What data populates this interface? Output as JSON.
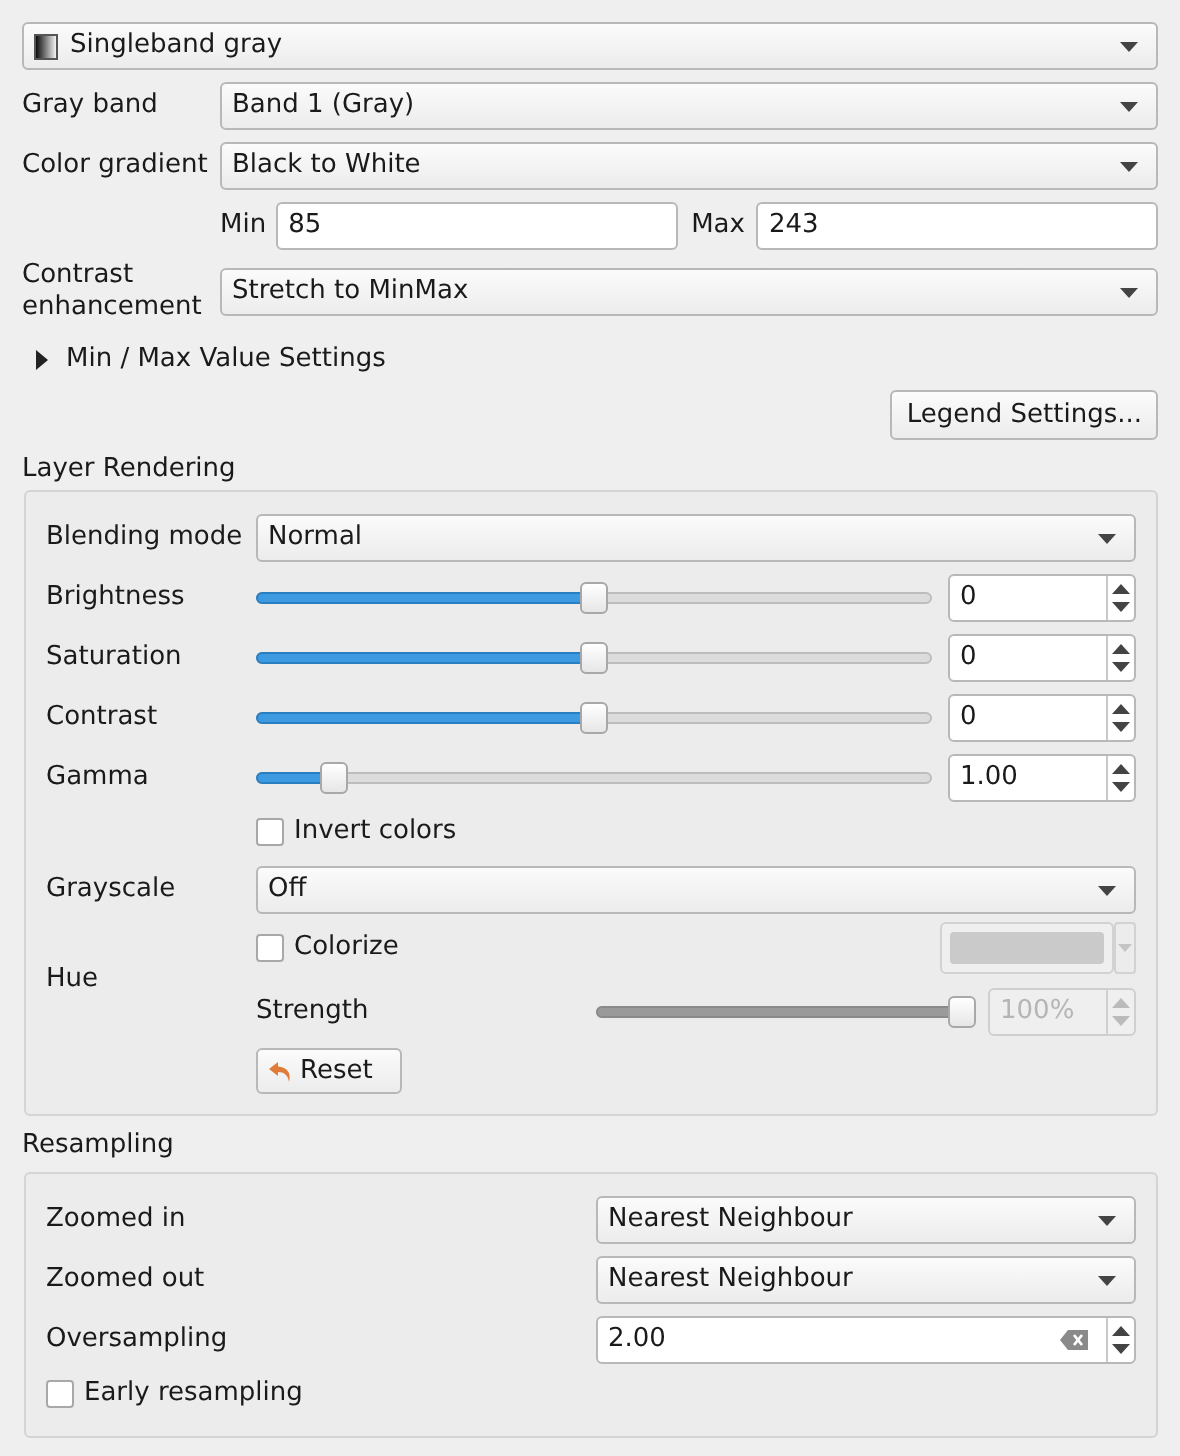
{
  "renderer": {
    "value": "Singleband gray"
  },
  "gray_band": {
    "label": "Gray band",
    "value": "Band 1 (Gray)"
  },
  "color_gradient": {
    "label": "Color gradient",
    "value": "Black to White"
  },
  "min": {
    "label": "Min",
    "value": "85"
  },
  "max": {
    "label": "Max",
    "value": "243"
  },
  "contrast_enhancement": {
    "label": "Contrast enhancement",
    "value": "Stretch to MinMax"
  },
  "min_max_settings": {
    "label": "Min / Max Value Settings",
    "expanded": false
  },
  "legend_button": "Legend Settings...",
  "layer_rendering": {
    "title": "Layer Rendering",
    "blending_mode": {
      "label": "Blending mode",
      "value": "Normal"
    },
    "sliders": [
      {
        "label": "Brightness",
        "level": 0.5,
        "value": "0"
      },
      {
        "label": "Saturation",
        "level": 0.5,
        "value": "0"
      },
      {
        "label": "Contrast",
        "level": 0.5,
        "value": "0"
      },
      {
        "label": "Gamma",
        "level": 0.1,
        "value": "1.00"
      }
    ],
    "invert_colors": {
      "label": "Invert colors",
      "checked": false
    },
    "grayscale": {
      "label": "Grayscale",
      "value": "Off"
    },
    "hue": {
      "label": "Hue",
      "colorize": {
        "label": "Colorize",
        "checked": false
      },
      "color_button": {
        "disabled": true
      },
      "strength": {
        "label": "Strength",
        "level": 1,
        "value": "100%",
        "disabled": true
      },
      "reset": "Reset"
    }
  },
  "resampling": {
    "title": "Resampling",
    "zoomed_in": {
      "label": "Zoomed in",
      "value": "Nearest Neighbour"
    },
    "zoomed_out": {
      "label": "Zoomed out",
      "value": "Nearest Neighbour"
    },
    "oversampling": {
      "label": "Oversampling",
      "value": "2.00"
    },
    "early_resampling": {
      "label": "Early resampling",
      "checked": false
    }
  }
}
